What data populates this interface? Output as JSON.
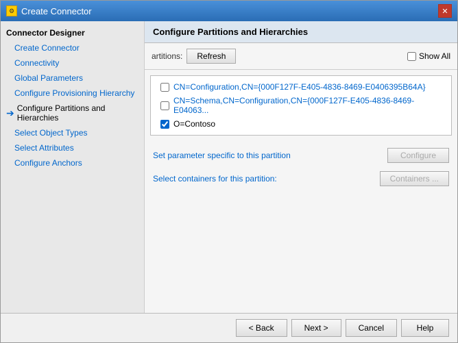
{
  "window": {
    "title": "Create Connector",
    "icon_label": "gear"
  },
  "sidebar": {
    "header": "Connector Designer",
    "items": [
      {
        "id": "create-connector",
        "label": "Create Connector",
        "active": false,
        "current": false
      },
      {
        "id": "connectivity",
        "label": "Connectivity",
        "active": false,
        "current": false
      },
      {
        "id": "global-parameters",
        "label": "Global Parameters",
        "active": false,
        "current": false
      },
      {
        "id": "configure-provisioning-hierarchy",
        "label": "Configure Provisioning Hierarchy",
        "active": false,
        "current": false
      },
      {
        "id": "configure-partitions",
        "label": "Configure Partitions and Hierarchies",
        "active": true,
        "current": true
      },
      {
        "id": "select-object-types",
        "label": "Select Object Types",
        "active": false,
        "current": false
      },
      {
        "id": "select-attributes",
        "label": "Select Attributes",
        "active": false,
        "current": false
      },
      {
        "id": "configure-anchors",
        "label": "Configure Anchors",
        "active": false,
        "current": false
      }
    ]
  },
  "main": {
    "header": "Configure Partitions and Hierarchies",
    "toolbar": {
      "partitions_label": "artitions:",
      "refresh_label": "Refresh",
      "show_all_label": "Show All"
    },
    "partitions": [
      {
        "id": "cn-configuration",
        "label": "CN=Configuration,CN={000F127F-E405-4836-8469-E0406395B64A}",
        "checked": false
      },
      {
        "id": "cn-schema",
        "label": "CN=Schema,CN=Configuration,CN={000F127F-E405-4836-8469-E04063...",
        "checked": false
      },
      {
        "id": "o-contoso",
        "label": "O=Contoso",
        "checked": true
      }
    ],
    "configure_label": "Set parameter specific to this partition",
    "configure_btn": "Configure",
    "containers_label": "Select containers for this partition:",
    "containers_btn": "Containers ..."
  },
  "footer": {
    "back_label": "< Back",
    "next_label": "Next >",
    "cancel_label": "Cancel",
    "help_label": "Help"
  }
}
